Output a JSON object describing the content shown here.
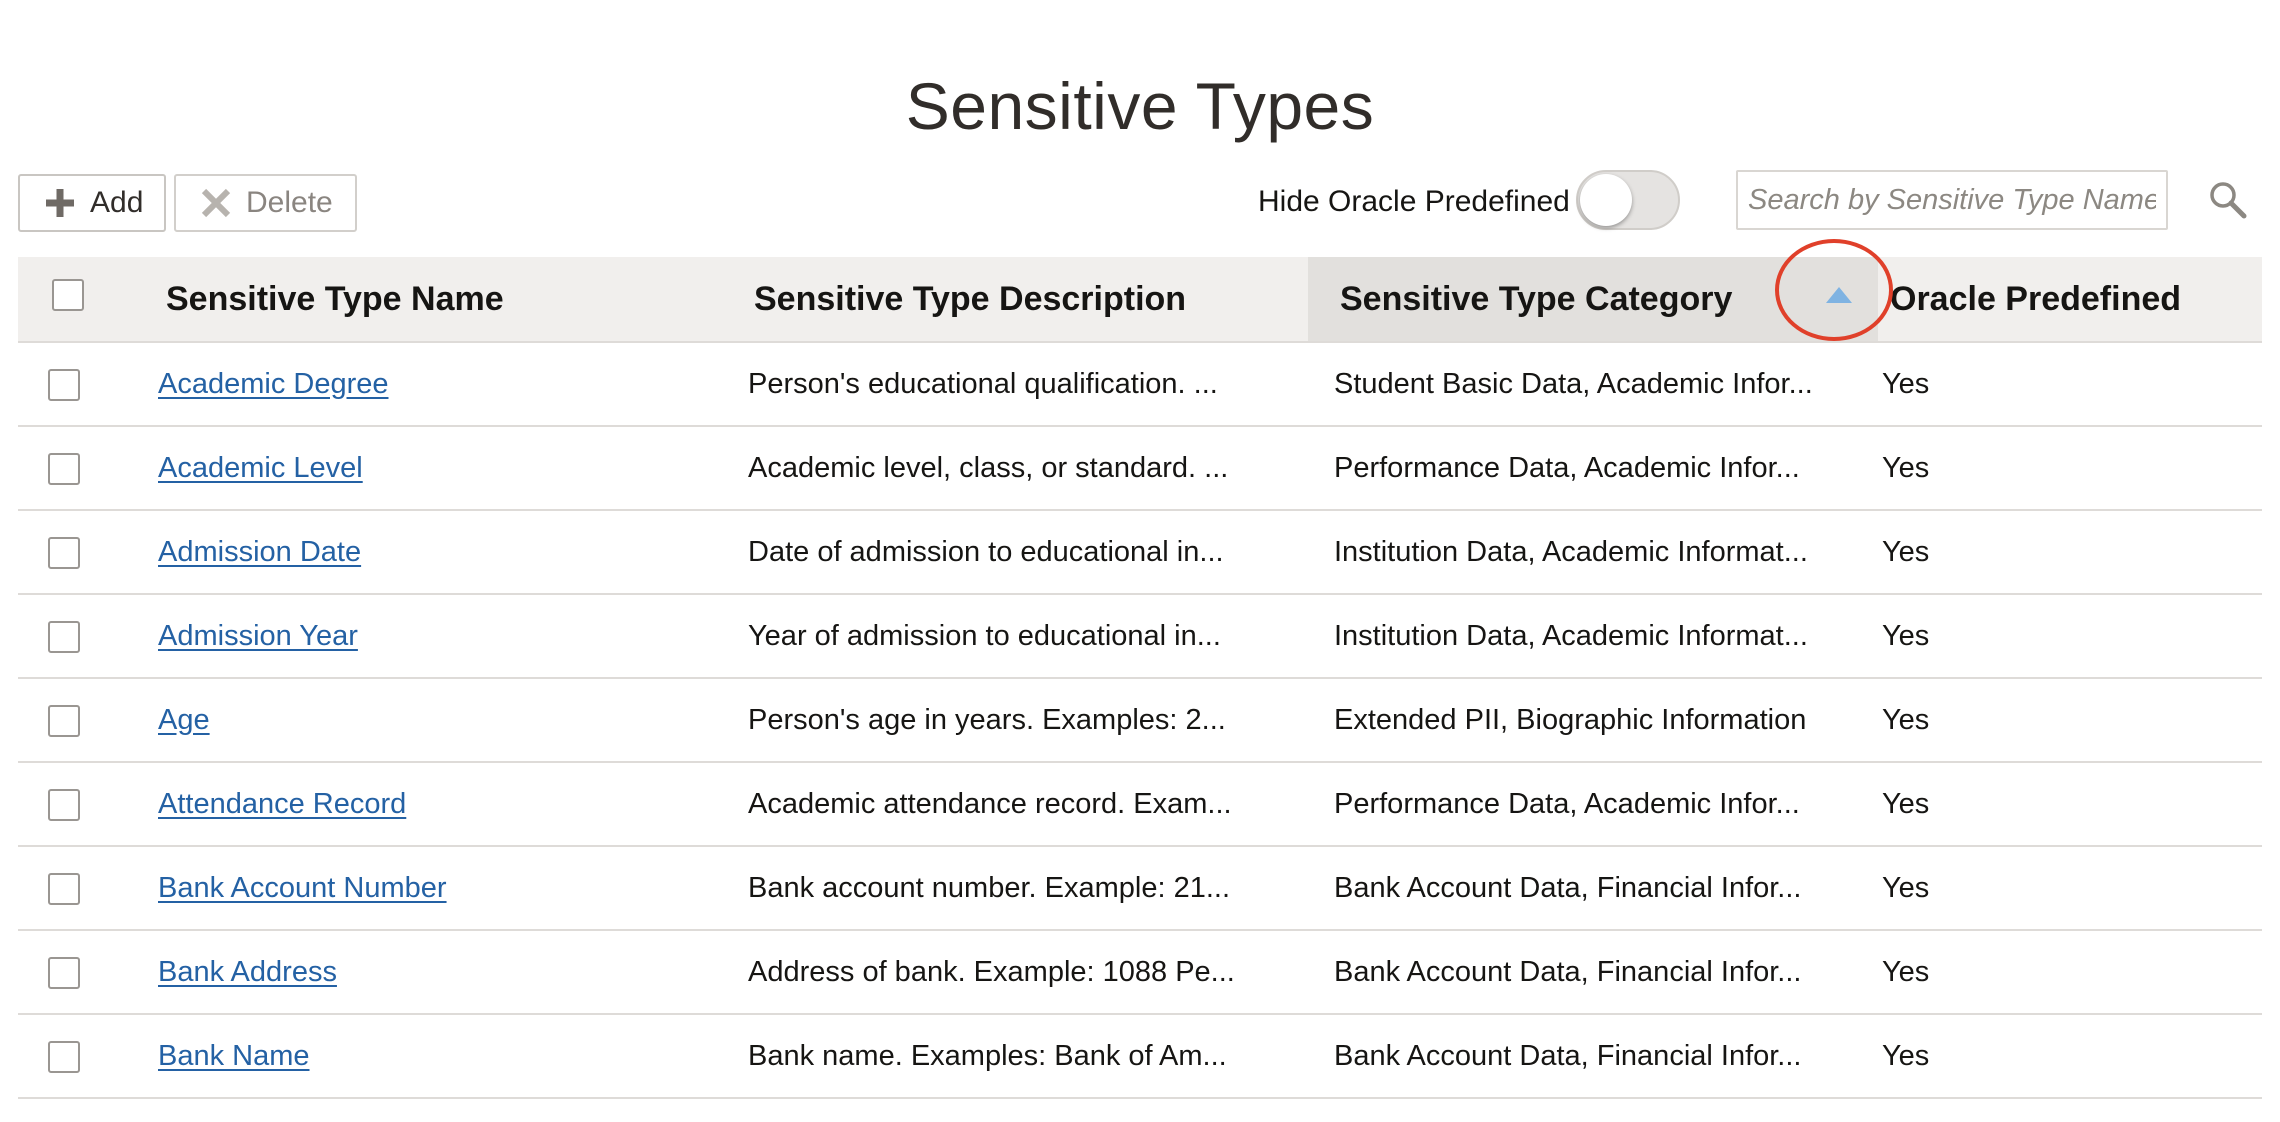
{
  "page": {
    "title": "Sensitive Types"
  },
  "toolbar": {
    "add_label": "Add",
    "delete_label": "Delete",
    "hide_predefined_label": "Hide Oracle Predefined",
    "hide_predefined_on": false,
    "search_placeholder": "Search by Sensitive Type Name",
    "search_value": ""
  },
  "icons": {
    "add": "plus-icon",
    "delete": "x-icon",
    "search": "magnifier-icon",
    "sort": "sort-ascending-icon"
  },
  "colors": {
    "link": "#2461a4",
    "sort_arrow": "#7fb3e2",
    "highlight": "#e0402a",
    "header_bg": "#f1efed",
    "sorted_header_bg": "#e2e0dd"
  },
  "table": {
    "columns": {
      "name": "Sensitive Type Name",
      "description": "Sensitive Type Description",
      "category": "Sensitive Type Category",
      "predefined": "Oracle Predefined"
    },
    "sorted_column": "category",
    "sort_direction": "ascending",
    "rows": [
      {
        "name": "Academic Degree",
        "description": "Person's educational qualification. ...",
        "category": "Student Basic Data, Academic Infor...",
        "predefined": "Yes"
      },
      {
        "name": "Academic Level",
        "description": "Academic level, class, or standard. ...",
        "category": "Performance Data, Academic Infor...",
        "predefined": "Yes"
      },
      {
        "name": "Admission Date",
        "description": "Date of admission to educational in...",
        "category": "Institution Data, Academic Informat...",
        "predefined": "Yes"
      },
      {
        "name": "Admission Year",
        "description": "Year of admission to educational in...",
        "category": "Institution Data, Academic Informat...",
        "predefined": "Yes"
      },
      {
        "name": "Age",
        "description": "Person's age in years. Examples: 2...",
        "category": "Extended PII, Biographic Information",
        "predefined": "Yes"
      },
      {
        "name": "Attendance Record",
        "description": "Academic attendance record. Exam...",
        "category": "Performance Data, Academic Infor...",
        "predefined": "Yes"
      },
      {
        "name": "Bank Account Number",
        "description": "Bank account number. Example: 21...",
        "category": "Bank Account Data, Financial Infor...",
        "predefined": "Yes"
      },
      {
        "name": "Bank Address",
        "description": "Address of bank. Example: 1088 Pe...",
        "category": "Bank Account Data, Financial Infor...",
        "predefined": "Yes"
      },
      {
        "name": "Bank Name",
        "description": "Bank name. Examples: Bank of Am...",
        "category": "Bank Account Data, Financial Infor...",
        "predefined": "Yes"
      }
    ]
  }
}
